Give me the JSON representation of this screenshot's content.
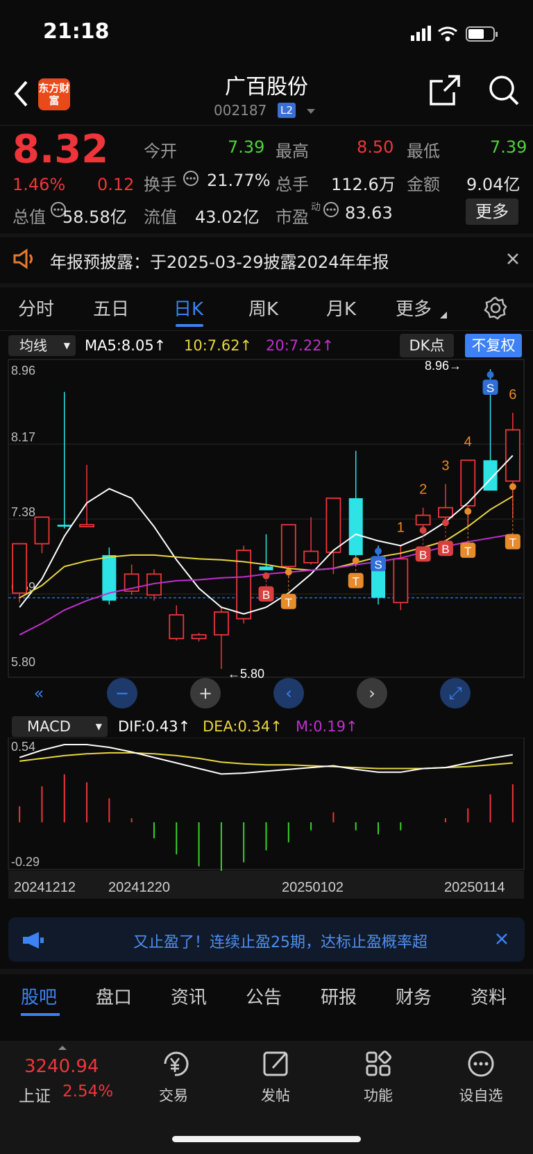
{
  "status": {
    "time": "21:18"
  },
  "header": {
    "logo": "东方财富",
    "title": "广百股份",
    "code": "002187",
    "level": "L2"
  },
  "quote": {
    "price": "8.32",
    "change_pct": "1.46%",
    "change": "0.12",
    "row1": [
      {
        "label": "今开",
        "value": "7.39",
        "color": "green"
      },
      {
        "label": "最高",
        "value": "8.50",
        "color": "red"
      },
      {
        "label": "最低",
        "value": "7.39",
        "color": "green"
      }
    ],
    "row2": [
      {
        "label": "换手",
        "value": "21.77%"
      },
      {
        "label": "总手",
        "value": "112.6万"
      },
      {
        "label": "金额",
        "value": "9.04亿"
      }
    ],
    "row3": [
      {
        "label": "总值",
        "value": "58.58亿"
      },
      {
        "label": "流值",
        "value": "43.02亿"
      },
      {
        "label": "市盈",
        "sup": "动",
        "value": "83.63"
      }
    ],
    "more": "更多"
  },
  "notice": {
    "text": "年报预披露：于2025-03-29披露2024年年报"
  },
  "tabs": [
    "分时",
    "五日",
    "日K",
    "周K",
    "月K",
    "更多"
  ],
  "indicators": {
    "ma_select": "均线",
    "ma5": "MA5:8.05↑",
    "ma10": "10:7.62↑",
    "ma20": "20:7.22↑",
    "dk": "DK点",
    "fq": "不复权",
    "macd_select": "MACD",
    "dif": "DIF:0.43↑",
    "dea": "DEA:0.34↑",
    "m": "M:0.19↑"
  },
  "chart_data": [
    {
      "type": "candlestick",
      "y_ticks": [
        "8.96",
        "8.17",
        "7.38",
        "6.59",
        "5.80"
      ],
      "ylim": [
        5.8,
        8.96
      ],
      "high_label": "8.96→",
      "low_label": "←5.80",
      "candles": [
        {
          "o": 6.6,
          "c": 7.12,
          "h": 7.12,
          "l": 6.5
        },
        {
          "o": 7.12,
          "c": 7.4,
          "h": 7.4,
          "l": 7.02
        },
        {
          "o": 7.32,
          "c": 7.3,
          "h": 8.72,
          "l": 7.28,
          "mark": "gap"
        },
        {
          "o": 7.3,
          "c": 7.32,
          "h": 7.95,
          "l": 7.3
        },
        {
          "o": 7.0,
          "c": 6.52,
          "h": 7.08,
          "l": 6.48
        },
        {
          "o": 6.62,
          "c": 6.8,
          "h": 6.9,
          "l": 6.58
        },
        {
          "o": 6.58,
          "c": 6.8,
          "h": 6.85,
          "l": 6.52
        },
        {
          "o": 6.12,
          "c": 6.37,
          "h": 6.47,
          "l": 6.1
        },
        {
          "o": 6.12,
          "c": 6.16,
          "h": 6.18,
          "l": 6.09
        },
        {
          "o": 6.16,
          "c": 6.4,
          "h": 6.45,
          "l": 5.8
        },
        {
          "o": 6.33,
          "c": 7.05,
          "h": 7.1,
          "l": 6.28
        },
        {
          "o": 6.88,
          "c": 6.84,
          "h": 7.22,
          "l": 6.84
        },
        {
          "o": 6.88,
          "c": 7.32,
          "h": 7.32,
          "l": 6.76
        },
        {
          "o": 6.92,
          "c": 7.04,
          "h": 7.4,
          "l": 6.9
        },
        {
          "o": 7.03,
          "c": 7.6,
          "h": 7.6,
          "l": 6.8
        },
        {
          "o": 7.6,
          "c": 7.0,
          "h": 8.1,
          "l": 6.98
        },
        {
          "o": 6.96,
          "c": 6.55,
          "h": 7.1,
          "l": 6.48
        },
        {
          "o": 6.5,
          "c": 6.96,
          "h": 7.1,
          "l": 6.42
        },
        {
          "o": 7.32,
          "c": 7.42,
          "h": 7.5,
          "l": 7.26
        },
        {
          "o": 7.4,
          "c": 7.5,
          "h": 7.75,
          "l": 7.32
        },
        {
          "o": 7.52,
          "c": 8.0,
          "h": 8.0,
          "l": 7.3
        },
        {
          "o": 8.0,
          "c": 7.68,
          "h": 8.96,
          "l": 7.68
        },
        {
          "o": 7.78,
          "c": 8.32,
          "h": 8.5,
          "l": 7.39
        }
      ],
      "series": [
        {
          "name": "MA5",
          "color": "#ffffff",
          "values": [
            6.45,
            6.75,
            7.2,
            7.55,
            7.7,
            7.6,
            7.3,
            6.95,
            6.65,
            6.45,
            6.38,
            6.45,
            6.6,
            6.8,
            7.05,
            7.22,
            7.15,
            7.1,
            7.2,
            7.35,
            7.55,
            7.8,
            8.05
          ]
        },
        {
          "name": "10",
          "color": "#e9d640",
          "values": [
            6.55,
            6.68,
            6.88,
            6.94,
            6.98,
            7.0,
            7.0,
            6.98,
            6.96,
            6.95,
            6.93,
            6.9,
            6.86,
            6.84,
            6.86,
            6.92,
            6.98,
            7.02,
            7.08,
            7.15,
            7.3,
            7.48,
            7.62
          ]
        },
        {
          "name": "20",
          "color": "#c12fd1",
          "values": [
            6.16,
            6.28,
            6.42,
            6.52,
            6.6,
            6.65,
            6.7,
            6.73,
            6.74,
            6.76,
            6.77,
            6.8,
            6.82,
            6.84,
            6.86,
            6.9,
            6.93,
            6.97,
            7.03,
            7.09,
            7.14,
            7.18,
            7.22
          ]
        }
      ],
      "signals": [
        {
          "i": 11,
          "label": "B",
          "type": "B"
        },
        {
          "i": 12,
          "label": "T",
          "type": "T"
        },
        {
          "i": 15,
          "label": "T",
          "type": "T"
        },
        {
          "i": 16,
          "label": "S",
          "type": "S"
        },
        {
          "i": 17,
          "label": "1",
          "type": "N"
        },
        {
          "i": 18,
          "label": "2",
          "type": "N"
        },
        {
          "i": 18,
          "label": "B",
          "type": "B"
        },
        {
          "i": 19,
          "label": "3",
          "type": "N"
        },
        {
          "i": 19,
          "label": "B",
          "type": "B"
        },
        {
          "i": 20,
          "label": "4",
          "type": "N"
        },
        {
          "i": 20,
          "label": "T",
          "type": "T"
        },
        {
          "i": 21,
          "label": "5",
          "type": "N"
        },
        {
          "i": 21,
          "label": "S",
          "type": "S"
        },
        {
          "i": 22,
          "label": "6",
          "type": "N"
        },
        {
          "i": 22,
          "label": "T",
          "type": "T"
        }
      ]
    },
    {
      "type": "macd",
      "y_ticks": [
        "0.54",
        "-0.29"
      ],
      "ylim": [
        -0.29,
        0.54
      ],
      "x_labels": [
        "20241212",
        "20241220",
        "20250102",
        "20250114"
      ],
      "dif": [
        0.4,
        0.48,
        0.54,
        0.54,
        0.51,
        0.46,
        0.4,
        0.34,
        0.28,
        0.22,
        0.23,
        0.25,
        0.27,
        0.29,
        0.31,
        0.27,
        0.24,
        0.24,
        0.28,
        0.29,
        0.34,
        0.39,
        0.43
      ],
      "dea": [
        0.36,
        0.39,
        0.42,
        0.44,
        0.45,
        0.45,
        0.44,
        0.42,
        0.39,
        0.35,
        0.33,
        0.32,
        0.32,
        0.31,
        0.3,
        0.29,
        0.28,
        0.28,
        0.28,
        0.29,
        0.3,
        0.32,
        0.34
      ],
      "m": [
        0.08,
        0.18,
        0.24,
        0.2,
        0.12,
        0.02,
        -0.08,
        -0.16,
        -0.22,
        -0.26,
        -0.2,
        -0.14,
        -0.1,
        -0.04,
        0.05,
        -0.04,
        -0.06,
        -0.04,
        0.0,
        0.02,
        0.07,
        0.14,
        0.19
      ]
    }
  ],
  "ad": {
    "text": "又止盈了！连续止盈25期，达标止盈概率超"
  },
  "bottom_tabs": [
    "股吧",
    "盘口",
    "资讯",
    "公告",
    "研报",
    "财务",
    "资料"
  ],
  "footer": {
    "index_value": "3240.94",
    "index_name": "上证",
    "index_change": "2.54%",
    "items": [
      "交易",
      "发帖",
      "功能",
      "设自选"
    ]
  }
}
